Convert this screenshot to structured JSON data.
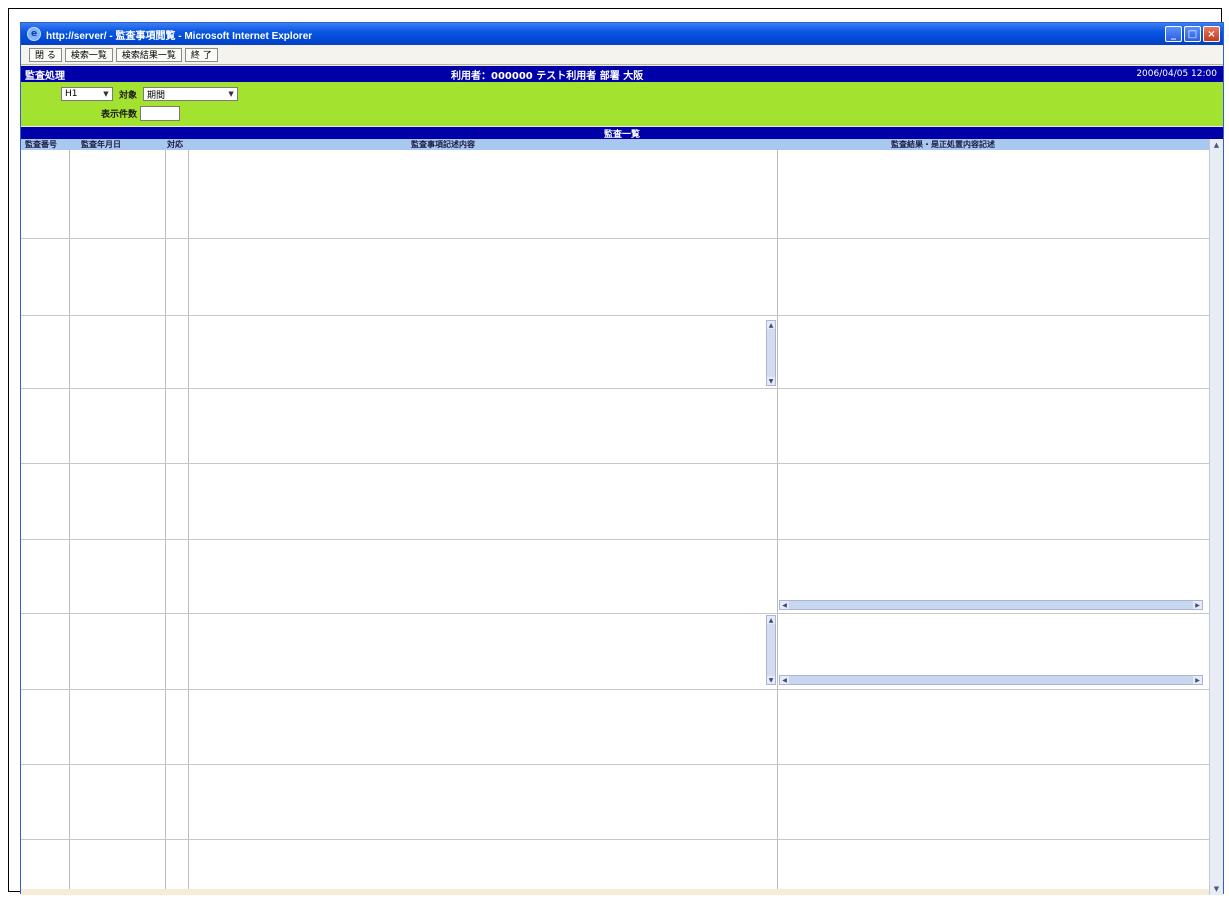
{
  "window": {
    "title": "http://server/ - 監査事項閲覧 - Microsoft Internet Explorer",
    "ie_icon": "e",
    "controls": {
      "minimize": "_",
      "maximize": "□",
      "close": "×"
    }
  },
  "toolbar": {
    "buttons": [
      "閉 る",
      "検索一覧",
      "検索結果一覧",
      "終 了"
    ]
  },
  "header": {
    "left": "監査処理",
    "center": "利用者：000000  テスト利用者  部署  大阪",
    "right": "2006/04/05 12:00"
  },
  "filter": {
    "period_select": "H1",
    "category_label": "対象",
    "category_value": "期間",
    "number_label": "表示件数"
  },
  "section": {
    "title": "監査一覧"
  },
  "columns": [
    "監査番号",
    "監査年月日",
    "対応",
    "監査事項記述内容",
    "監査結果・是正処置内容記述"
  ],
  "icons": {
    "scroll_up": "▲",
    "scroll_down": "▼",
    "scroll_left": "◀",
    "scroll_right": "▶"
  }
}
